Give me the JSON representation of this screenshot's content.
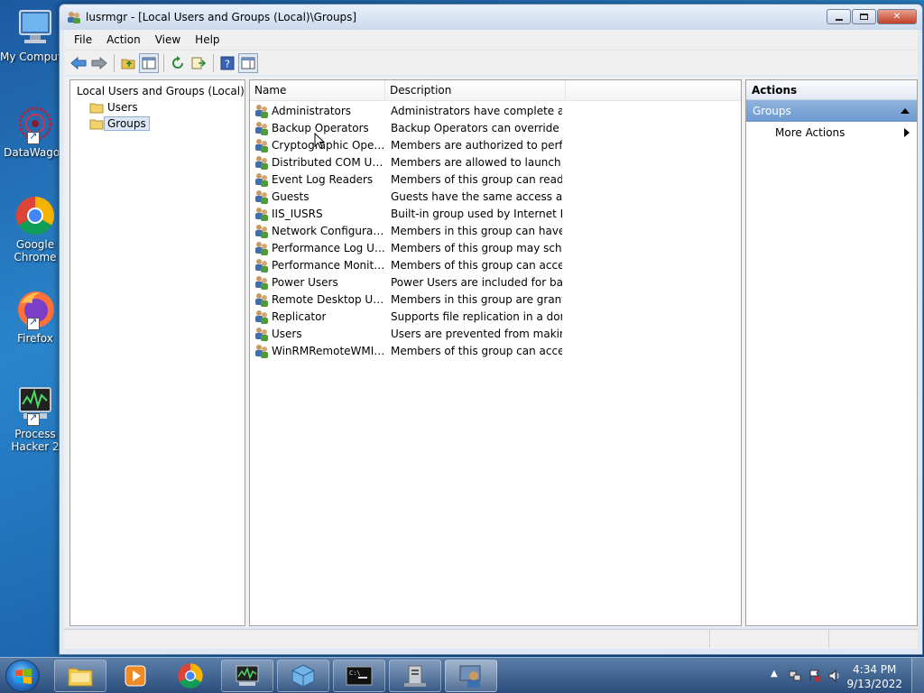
{
  "desktop": {
    "icons": [
      {
        "label": "My Computer",
        "icon": "computer-icon"
      },
      {
        "label": "DataWagon",
        "icon": "datawagon-icon"
      },
      {
        "label": "Google Chrome",
        "icon": "chrome-icon"
      },
      {
        "label": "Firefox",
        "icon": "firefox-icon"
      },
      {
        "label": "Process Hacker 2",
        "icon": "process-hacker-icon"
      }
    ]
  },
  "window": {
    "title": "lusrmgr - [Local Users and Groups (Local)\\Groups]",
    "controls": {
      "minimize": "minimize-icon",
      "maximize": "maximize-icon",
      "close": "close-icon"
    }
  },
  "menu": {
    "file": "File",
    "action": "Action",
    "view": "View",
    "help": "Help"
  },
  "tree": {
    "root": "Local Users and Groups (Local)",
    "users": "Users",
    "groups": "Groups"
  },
  "list": {
    "col_name": "Name",
    "col_description": "Description",
    "rows": [
      {
        "name": "Administrators",
        "description": "Administrators have complete an..."
      },
      {
        "name": "Backup Operators",
        "description": "Backup Operators can override se..."
      },
      {
        "name": "Cryptographic Operat...",
        "description": "Members are authorized to perfor..."
      },
      {
        "name": "Distributed COM Users",
        "description": "Members are allowed to launch, a..."
      },
      {
        "name": "Event Log Readers",
        "description": "Members of this group can read e..."
      },
      {
        "name": "Guests",
        "description": "Guests have the same access as m..."
      },
      {
        "name": "IIS_IUSRS",
        "description": "Built-in group used by Internet Inf..."
      },
      {
        "name": "Network Configuratio...",
        "description": "Members in this group can have s..."
      },
      {
        "name": "Performance Log Users",
        "description": "Members of this group may sche..."
      },
      {
        "name": "Performance Monitor ...",
        "description": "Members of this group can acces..."
      },
      {
        "name": "Power Users",
        "description": "Power Users are included for back..."
      },
      {
        "name": "Remote Desktop Users",
        "description": "Members in this group are grante..."
      },
      {
        "name": "Replicator",
        "description": "Supports file replication in a dom..."
      },
      {
        "name": "Users",
        "description": "Users are prevented from making ..."
      },
      {
        "name": "WinRMRemoteWMIU...",
        "description": "Members of this group can acces..."
      }
    ]
  },
  "actions": {
    "header": "Actions",
    "group": "Groups",
    "more": "More Actions"
  },
  "taskbar": {
    "time": "4:34 PM",
    "date": "9/13/2022"
  },
  "colors": {
    "accent": "#6d9ad0",
    "selection": "#dde8f6"
  }
}
